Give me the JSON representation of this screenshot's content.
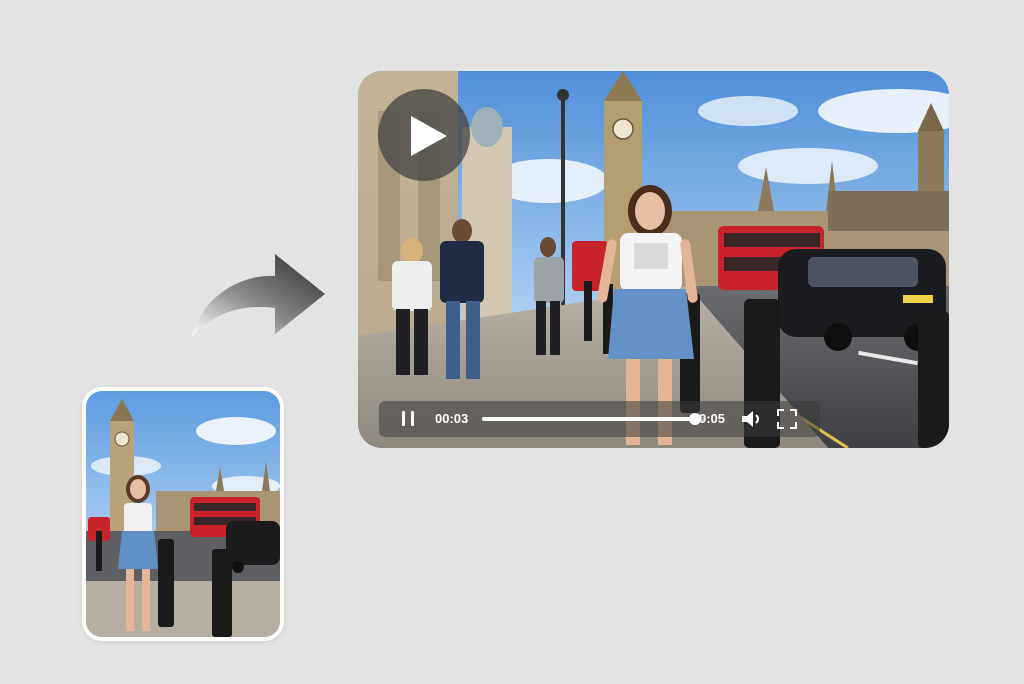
{
  "player": {
    "time_current": "00:03",
    "time_total": "0:05",
    "progress_fraction": 0.95
  },
  "icons": {
    "play": "play-icon",
    "pause": "pause-icon",
    "volume": "volume-icon",
    "fullscreen": "fullscreen-icon",
    "arrow": "curved-arrow-icon"
  },
  "colors": {
    "background": "#e3e3e3",
    "card_border": "#ffffff",
    "controls_bg": "rgba(60,60,60,0.55)",
    "play_button_bg": "rgba(70,70,70,0.78)",
    "progress_fill": "#ffffff"
  }
}
